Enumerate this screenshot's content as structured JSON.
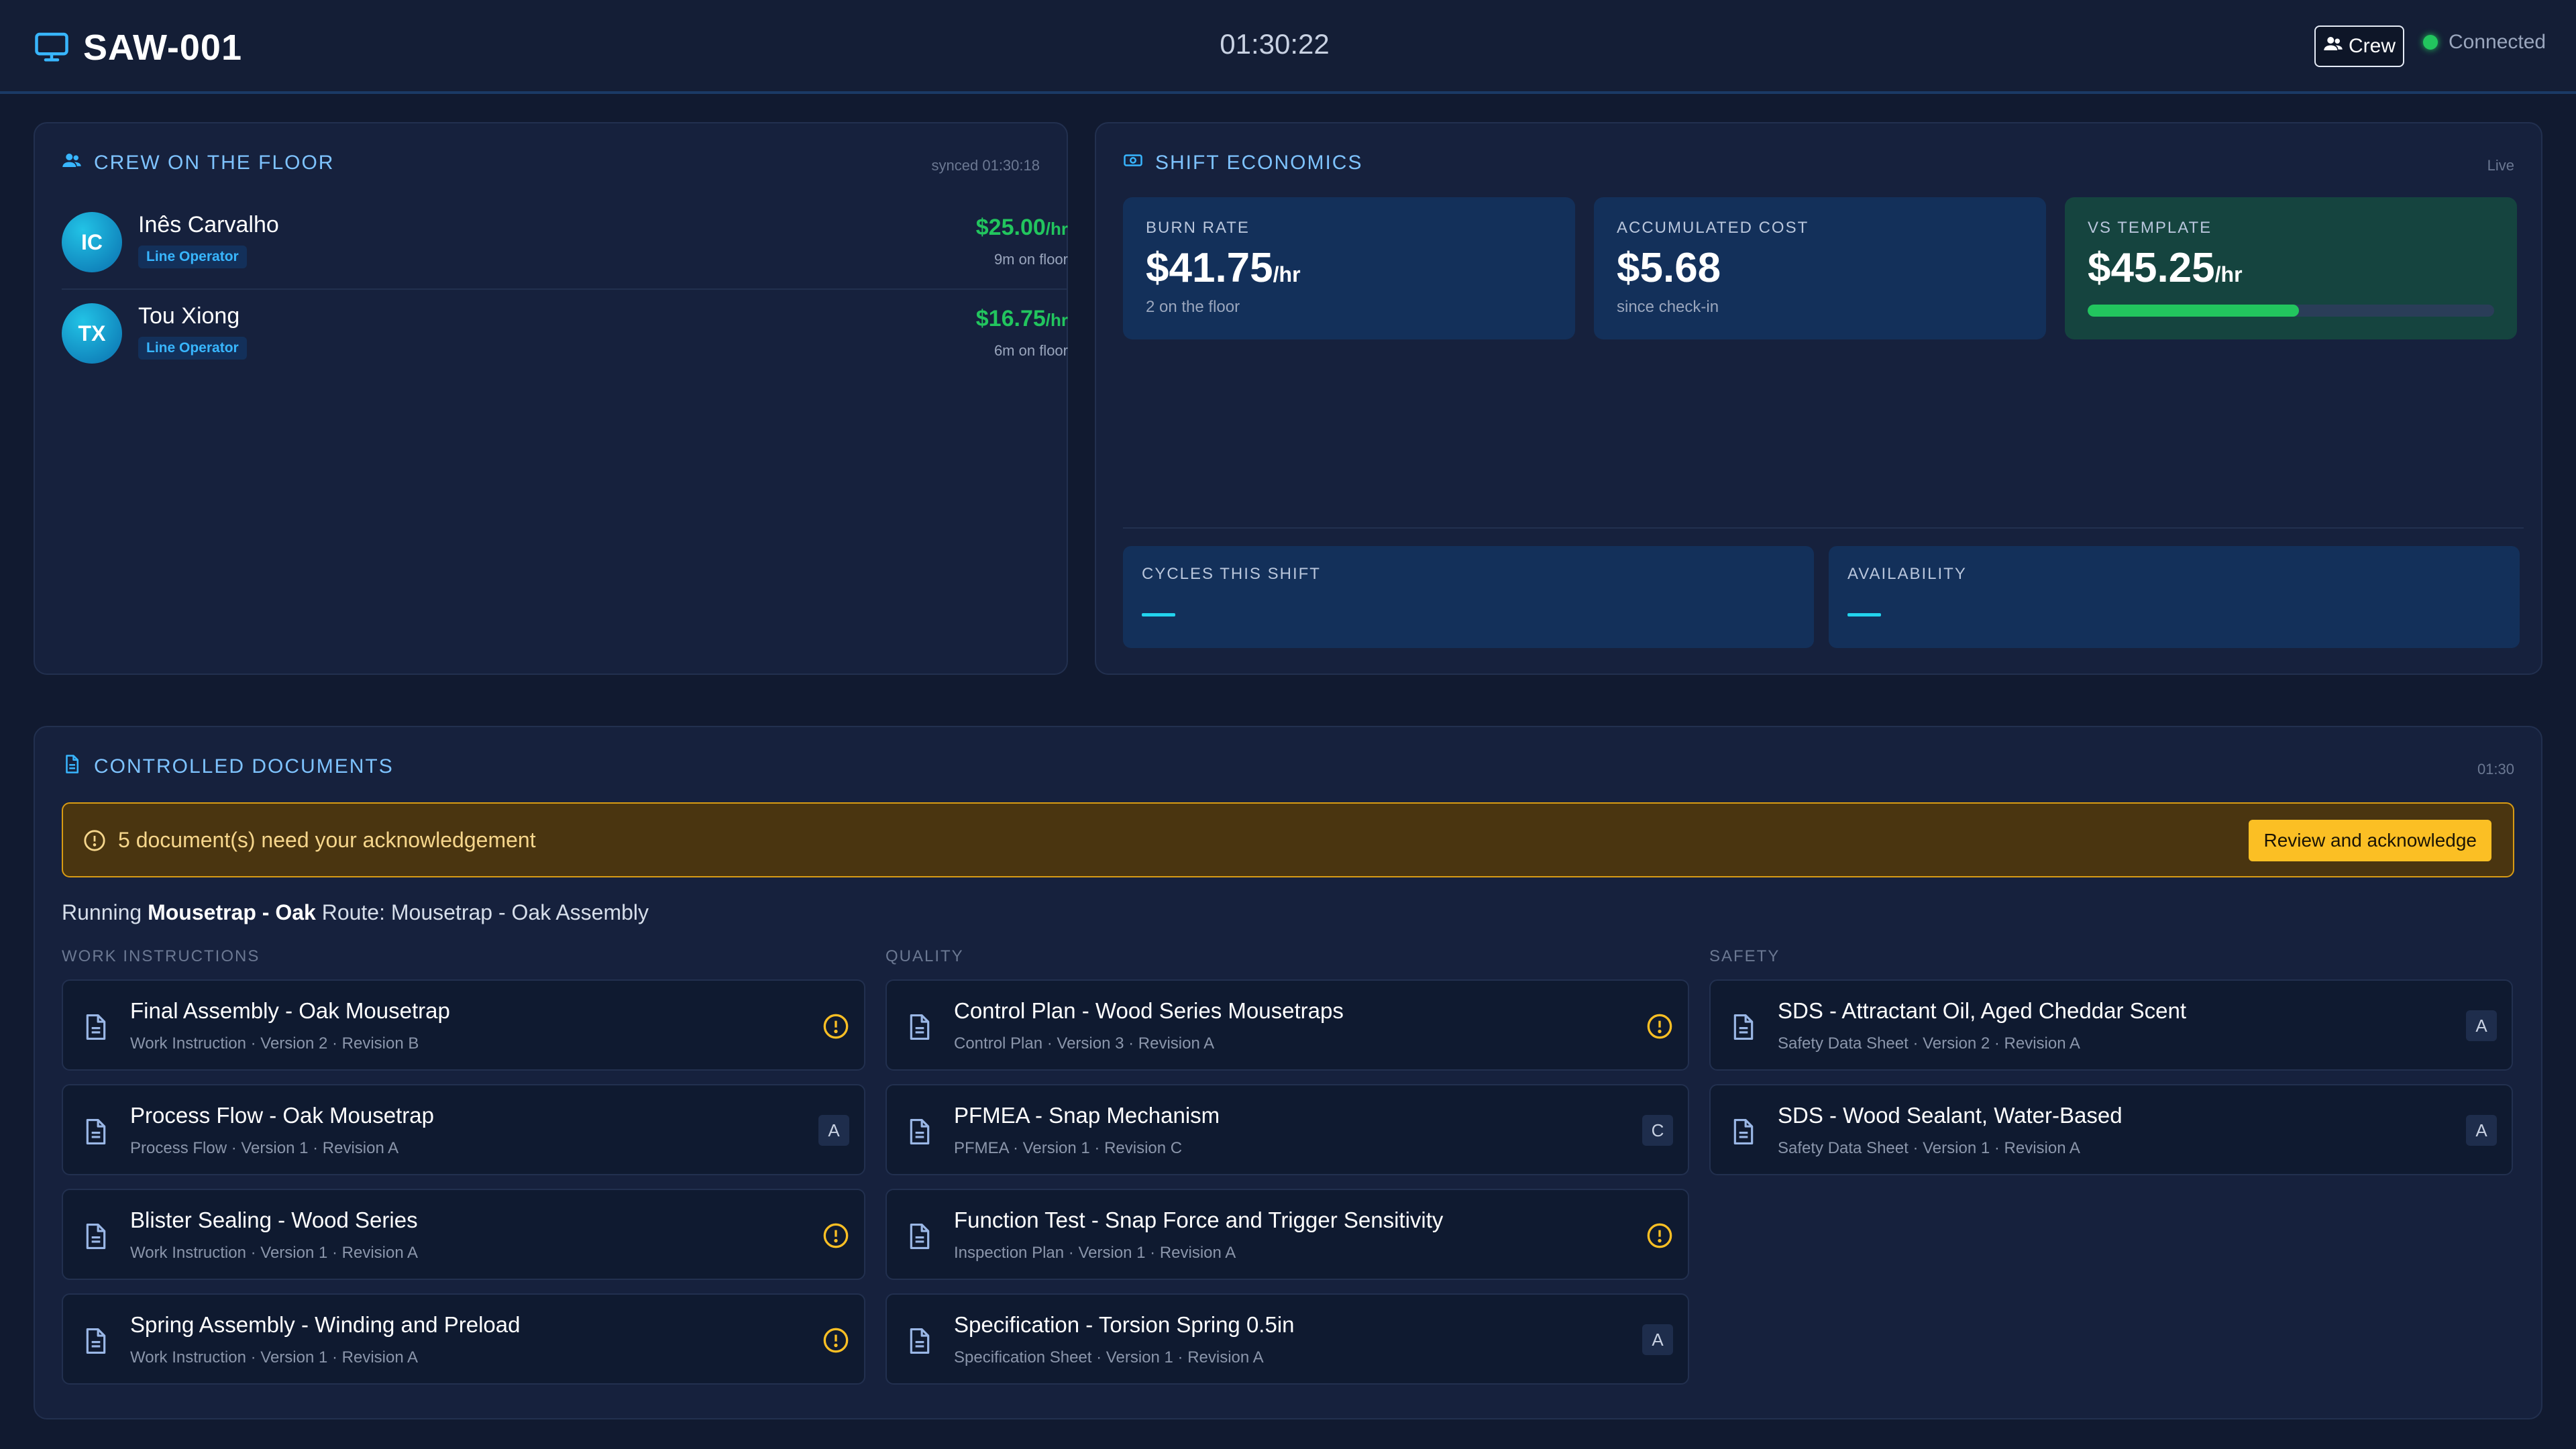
{
  "header": {
    "station": "SAW-001",
    "clock": "01:30:22",
    "crew_button": "Crew",
    "connection_status": "Connected"
  },
  "crew_panel": {
    "title": "CREW ON THE FLOOR",
    "sync_note": "synced 01:30:18",
    "members": [
      {
        "initials": "IC",
        "name": "Inês Carvalho",
        "role": "Line Operator",
        "rate": "$25.00",
        "rate_unit": "/hr",
        "time_on_floor": "9m on floor"
      },
      {
        "initials": "TX",
        "name": "Tou Xiong",
        "role": "Line Operator",
        "rate": "$16.75",
        "rate_unit": "/hr",
        "time_on_floor": "6m on floor"
      }
    ]
  },
  "economics": {
    "title": "SHIFT ECONOMICS",
    "status": "Live",
    "burn_rate": {
      "label": "BURN RATE",
      "value": "$41.75",
      "unit": "/hr",
      "sub": "2 on the floor"
    },
    "accumulated": {
      "label": "ACCUMULATED COST",
      "value": "$5.68",
      "sub": "since check-in"
    },
    "vs_template": {
      "label": "VS TEMPLATE",
      "value": "$45.25",
      "unit": "/hr",
      "progress_fraction": 0.52
    },
    "cycles": {
      "label": "CYCLES THIS SHIFT"
    },
    "availability": {
      "label": "AVAILABILITY"
    }
  },
  "documents": {
    "title": "CONTROLLED DOCUMENTS",
    "time": "01:30",
    "alert_text": "5 document(s) need your acknowledgement",
    "alert_button": "Review and acknowledge",
    "running_prefix": "Running",
    "running_product": "Mousetrap - Oak",
    "route_text": "Route: Mousetrap - Oak Assembly",
    "columns": {
      "work": "WORK INSTRUCTIONS",
      "quality": "QUALITY",
      "safety": "SAFETY"
    },
    "work_instructions": [
      {
        "title": "Final Assembly - Oak Mousetrap",
        "sub": "Work Instruction · Version 2 · Revision B",
        "status": "warning"
      },
      {
        "title": "Process Flow - Oak Mousetrap",
        "sub": "Process Flow · Version 1 · Revision A",
        "status": "badge",
        "badge": "A"
      },
      {
        "title": "Blister Sealing - Wood Series",
        "sub": "Work Instruction · Version 1 · Revision A",
        "status": "warning"
      },
      {
        "title": "Spring Assembly - Winding and Preload",
        "sub": "Work Instruction · Version 1 · Revision A",
        "status": "warning"
      }
    ],
    "quality": [
      {
        "title": "Control Plan - Wood Series Mousetraps",
        "sub": "Control Plan · Version 3 · Revision A",
        "status": "warning"
      },
      {
        "title": "PFMEA - Snap Mechanism",
        "sub": "PFMEA · Version 1 · Revision C",
        "status": "badge",
        "badge": "C"
      },
      {
        "title": "Function Test - Snap Force and Trigger Sensitivity",
        "sub": "Inspection Plan · Version 1 · Revision A",
        "status": "warning"
      },
      {
        "title": "Specification - Torsion Spring 0.5in",
        "sub": "Specification Sheet · Version 1 · Revision A",
        "status": "badge",
        "badge": "A"
      }
    ],
    "safety": [
      {
        "title": "SDS - Attractant Oil, Aged Cheddar Scent",
        "sub": "Safety Data Sheet · Version 2 · Revision A",
        "status": "badge",
        "badge": "A"
      },
      {
        "title": "SDS - Wood Sealant, Water-Based",
        "sub": "Safety Data Sheet · Version 1 · Revision A",
        "status": "badge",
        "badge": "A"
      }
    ]
  }
}
